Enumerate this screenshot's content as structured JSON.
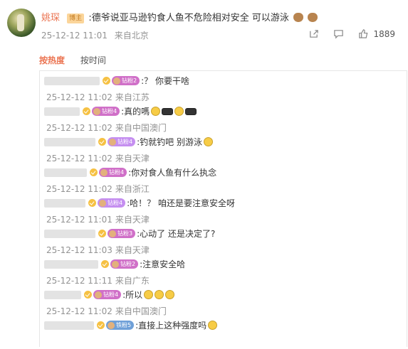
{
  "post": {
    "author": "姚琛",
    "role_badge": "博主",
    "text": ":德爷说亚马逊钓食人鱼不危险相对安全 可以游泳",
    "emoji_trailing": "money-bag-emoji",
    "time": "25-12-12 11:01",
    "location": "来自北京",
    "like_count": "1889",
    "icons": [
      "share-icon",
      "comment-icon",
      "like-icon"
    ]
  },
  "tabs": [
    {
      "label": "按热度",
      "active": true
    },
    {
      "label": "按时间",
      "active": false
    }
  ],
  "replies": [
    {
      "badge": "钻粉2",
      "badge_color": "#d070c8",
      "text": ":？ 你要干啥",
      "emoji": [],
      "time": "25-12-12 11:02",
      "location": "来自江苏"
    },
    {
      "badge": "钻粉4",
      "badge_color": "#d070c8",
      "text": ":真的嗎",
      "emoji": [
        "face",
        "dark",
        "face",
        "dark"
      ],
      "time": "25-12-12 11:02",
      "location": "来自中国澳门"
    },
    {
      "badge": "钻粉4",
      "badge_color": "#c58ff0",
      "text": ":钓就钓吧  别游泳",
      "emoji": [
        "face"
      ],
      "time": "25-12-12 11:02",
      "location": "来自天津"
    },
    {
      "badge": "钻粉4",
      "badge_color": "#d070c8",
      "text": ":你对食人鱼有什么执念",
      "emoji": [],
      "time": "25-12-12 11:02",
      "location": "来自浙江"
    },
    {
      "badge": "钻粉4",
      "badge_color": "#c58ff0",
      "text": ":哈！？ 咱还是要注意安全呀",
      "emoji": [],
      "time": "25-12-12 11:01",
      "location": "来自天津"
    },
    {
      "badge": "钻粉3",
      "badge_color": "#d070c8",
      "text": ":心动了 还是决定了?",
      "emoji": [],
      "time": "25-12-12 11:03",
      "location": "来自天津"
    },
    {
      "badge": "钻粉2",
      "badge_color": "#d070c8",
      "text": ":注意安全哈",
      "emoji": [],
      "time": "25-12-12 11:11",
      "location": "来自广东"
    },
    {
      "badge": "钻粉4",
      "badge_color": "#d070c8",
      "text": ":所以",
      "emoji": [
        "face",
        "face",
        "face"
      ],
      "time": "25-12-12 11:02",
      "location": "来自中国澳门"
    },
    {
      "badge": "铁粉5",
      "badge_color": "#6fa0d8",
      "text": ":直接上这种强度吗",
      "emoji": [
        "face"
      ],
      "time": "",
      "location": ""
    }
  ]
}
